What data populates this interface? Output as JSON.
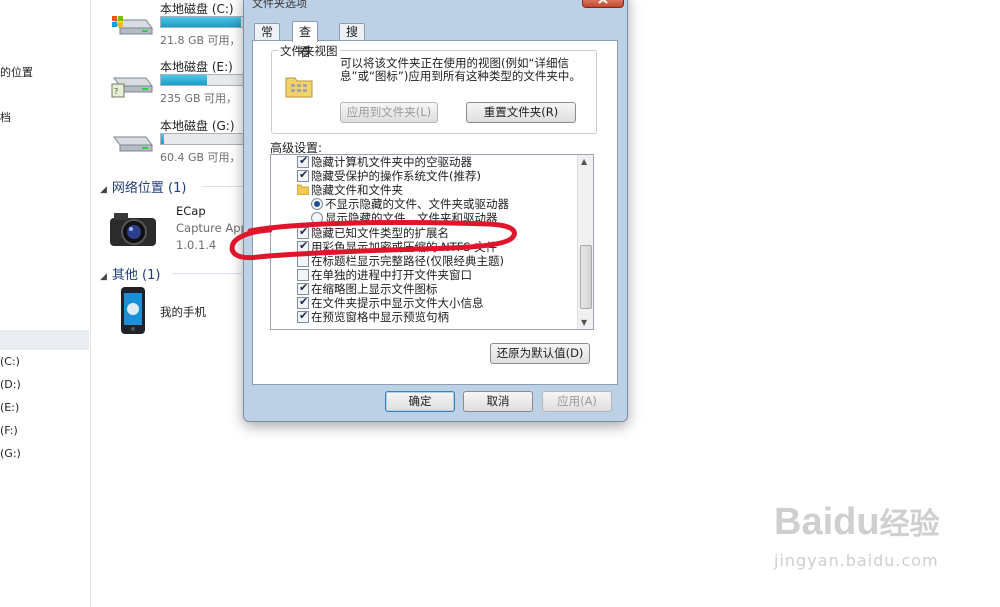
{
  "left_nav": {
    "items": [
      {
        "label": "的位置"
      },
      {
        "label": "档"
      },
      {
        "label": "(C:)"
      },
      {
        "label": "(D:)"
      },
      {
        "label": "(E:)"
      },
      {
        "label": "(F:)"
      },
      {
        "label": "(G:)"
      }
    ]
  },
  "explorer": {
    "drives": [
      {
        "name": "本地磁盘 (C:)",
        "size_text": "21.8 GB 可用，",
        "used_fraction": 0.83,
        "bar_color": "#1b9cc6"
      },
      {
        "name": "本地磁盘 (E:)",
        "size_text": "235 GB 可用，",
        "used_fraction": 0.48,
        "bar_color": "#1b9cc6"
      },
      {
        "name": "本地磁盘 (G:)",
        "size_text": "60.4 GB 可用，",
        "used_fraction": 0.03,
        "bar_color": "#1b9cc6"
      }
    ],
    "groups": [
      {
        "title": "网络位置 (1)"
      },
      {
        "title": "其他 (1)"
      }
    ],
    "ecap": {
      "name": "ECap",
      "line2": "Capture Appli",
      "line3": "1.0.1.4"
    },
    "phone": {
      "name": "我的手机"
    }
  },
  "dialog": {
    "title": "文件夹选项",
    "tabs": [
      {
        "label": "常规",
        "active": false
      },
      {
        "label": "查看",
        "active": true
      },
      {
        "label": "搜索",
        "active": false
      }
    ],
    "folder_views": {
      "legend": "文件夹视图",
      "description": "可以将该文件夹正在使用的视图(例如“详细信息”或“图标”)应用到所有这种类型的文件夹中。",
      "apply_button": "应用到文件夹(L)",
      "reset_button": "重置文件夹(R)"
    },
    "advanced_label": "高级设置:",
    "advanced_items": [
      {
        "kind": "checkbox",
        "checked": true,
        "label": "隐藏计算机文件夹中的空驱动器"
      },
      {
        "kind": "checkbox",
        "checked": true,
        "label": "隐藏受保护的操作系统文件(推荐)"
      },
      {
        "kind": "folder",
        "label": "隐藏文件和文件夹"
      },
      {
        "kind": "radio",
        "checked": true,
        "label": "不显示隐藏的文件、文件夹或驱动器"
      },
      {
        "kind": "radio",
        "checked": false,
        "label": "显示隐藏的文件、文件夹和驱动器"
      },
      {
        "kind": "checkbox",
        "checked": true,
        "label": "隐藏已知文件类型的扩展名"
      },
      {
        "kind": "checkbox",
        "checked": true,
        "label": "用彩色显示加密或压缩的 NTFS 文件"
      },
      {
        "kind": "checkbox",
        "checked": false,
        "label": "在标题栏显示完整路径(仅限经典主题)"
      },
      {
        "kind": "checkbox",
        "checked": false,
        "label": "在单独的进程中打开文件夹窗口"
      },
      {
        "kind": "checkbox",
        "checked": true,
        "label": "在缩略图上显示文件图标"
      },
      {
        "kind": "checkbox",
        "checked": true,
        "label": "在文件夹提示中显示文件大小信息"
      },
      {
        "kind": "checkbox",
        "checked": true,
        "label": "在预览窗格中显示预览句柄"
      }
    ],
    "restore_defaults": "还原为默认值(D)",
    "ok": "确定",
    "cancel": "取消",
    "apply": "应用(A)"
  },
  "annotation": {
    "color": "#e0152b"
  },
  "watermark": {
    "logo_text": "Baidu",
    "logo_cn": "经验",
    "url": "jingyan.baidu.com"
  }
}
